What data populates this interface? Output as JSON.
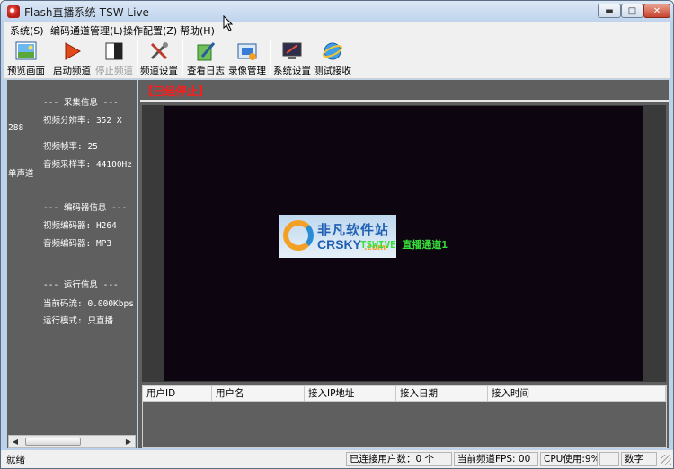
{
  "window": {
    "title": "Flash直播系统-TSW-Live",
    "controls": {
      "minimize": "▬",
      "maximize": "□",
      "close": "✕"
    }
  },
  "menu": {
    "items": [
      {
        "label": "系统(S)"
      },
      {
        "label": "编码通道管理(L)"
      },
      {
        "label": "操作配置(Z)"
      },
      {
        "label": "帮助(H)"
      }
    ]
  },
  "toolbar": {
    "buttons": [
      {
        "label": "预览画面",
        "icon": "preview-image-icon",
        "enabled": true
      },
      {
        "label": "启动频道",
        "icon": "play-triangle-icon",
        "enabled": true
      },
      {
        "label": "停止频道",
        "icon": "stop-contrast-icon",
        "enabled": false
      },
      {
        "label": "频道设置",
        "icon": "tools-settings-icon",
        "enabled": true
      },
      {
        "label": "查看日志",
        "icon": "pen-log-icon",
        "enabled": true
      },
      {
        "label": "录像管理",
        "icon": "video-record-icon",
        "enabled": true
      },
      {
        "label": "系统设置",
        "icon": "monitor-settings-icon",
        "enabled": true
      },
      {
        "label": "测试接收",
        "icon": "globe-ie-icon",
        "enabled": true
      }
    ]
  },
  "info_panel": {
    "capture_header": "--- 采集信息 ---",
    "video_resolution": "视频分辨率: 352 X",
    "video_resolution_wrap": "288",
    "video_fps": "视频帧率: 25",
    "audio_samplerate": "音频采样率: 44100Hz",
    "audio_channels": "单声道",
    "encoder_header": "--- 编码器信息 ---",
    "video_encoder": "视频编码器: H264",
    "audio_encoder": "音频编码器: MP3",
    "runtime_header": "--- 运行信息 ---",
    "bitrate": "当前码流: 0.000Kbps",
    "run_mode": "运行模式: 只直播"
  },
  "video": {
    "status": "【已经停止】",
    "watermark_cn": "非凡软件站",
    "watermark_en": "CRSKY",
    "watermark_com": ".com",
    "channel_overlay": "TSWIVE 直播通道1"
  },
  "user_table": {
    "columns": [
      "用户ID",
      "用户名",
      "接入IP地址",
      "接入日期",
      "接入时间"
    ],
    "rows": []
  },
  "statusbar": {
    "ready": "就绪",
    "connected_users": "已连接用户数：0 个",
    "fps": "当前频道FPS: 00",
    "cpu": "CPU使用:9%",
    "blank": "",
    "num": "数字"
  },
  "colors": {
    "panel_bg": "#5f5f5f",
    "video_bg": "#0d0510",
    "stopped_red": "#ff1a1a",
    "overlay_green": "#36e03a"
  }
}
